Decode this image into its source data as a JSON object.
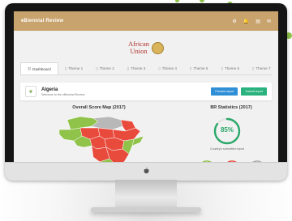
{
  "app": {
    "title": "eBiennial Review"
  },
  "topbar": {
    "icons": [
      "gear-icon",
      "bell-icon",
      "document-icon",
      "mail-icon"
    ]
  },
  "logo": {
    "line1": "African",
    "line2": "Union"
  },
  "tabs": [
    {
      "label": "Dashboard",
      "active": true
    },
    {
      "label": "Theme 1",
      "active": false
    },
    {
      "label": "Theme 2",
      "active": false
    },
    {
      "label": "Theme 3",
      "active": false
    },
    {
      "label": "Theme 4",
      "active": false
    },
    {
      "label": "Theme 5",
      "active": false
    },
    {
      "label": "Theme 6",
      "active": false
    },
    {
      "label": "Theme 7",
      "active": false
    }
  ],
  "country_card": {
    "title": "Algeria",
    "subtitle": "Welcome to the eBiennial Review",
    "preview_label": "Preview report",
    "submit_label": "Submit report"
  },
  "map_section": {
    "title": "Overall Score Map (2017)"
  },
  "stats_section": {
    "title": "BR Statistics (2017)",
    "percent": "85%",
    "percent_value": 85,
    "caption": "Country's submitted report"
  },
  "colors": {
    "accent": "#c8a36d",
    "on_track": "#8fc34a",
    "off_track": "#e84a3c",
    "ring": "#2aa86a"
  }
}
